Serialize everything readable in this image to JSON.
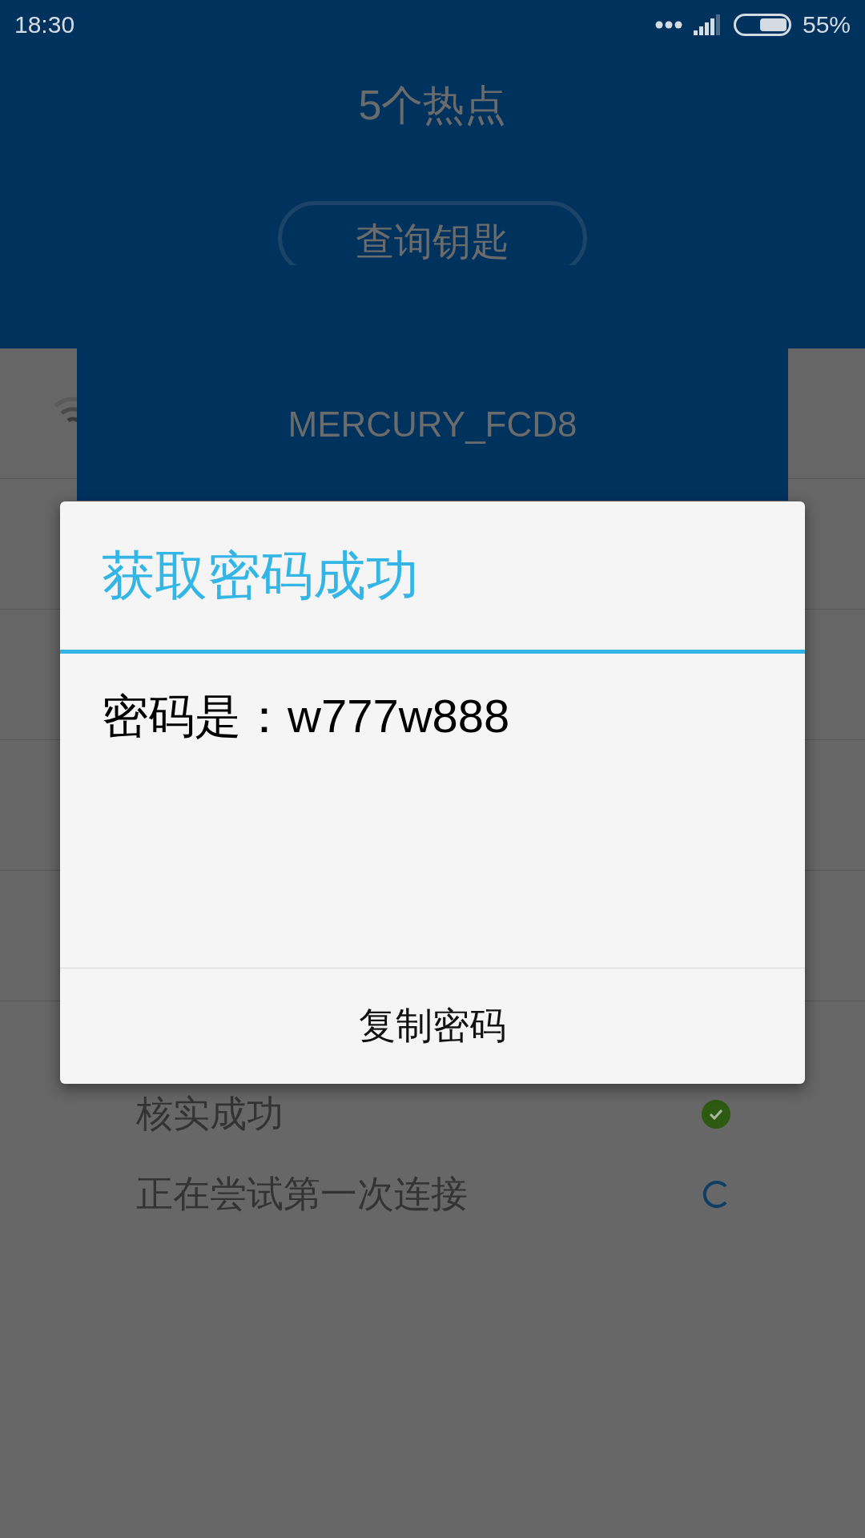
{
  "status_bar": {
    "time": "18:30",
    "battery": "55%"
  },
  "header": {
    "title": "5个热点",
    "button": "查询钥匙"
  },
  "network_card": {
    "ssid": "MERCURY_FCD8",
    "steps": [
      {
        "label": "核实成功",
        "kind": "done"
      },
      {
        "label": "正在尝试第一次连接",
        "kind": "loading"
      }
    ]
  },
  "dialog": {
    "title": "获取密码成功",
    "message": "密码是：w777w888",
    "button": "复制密码"
  }
}
